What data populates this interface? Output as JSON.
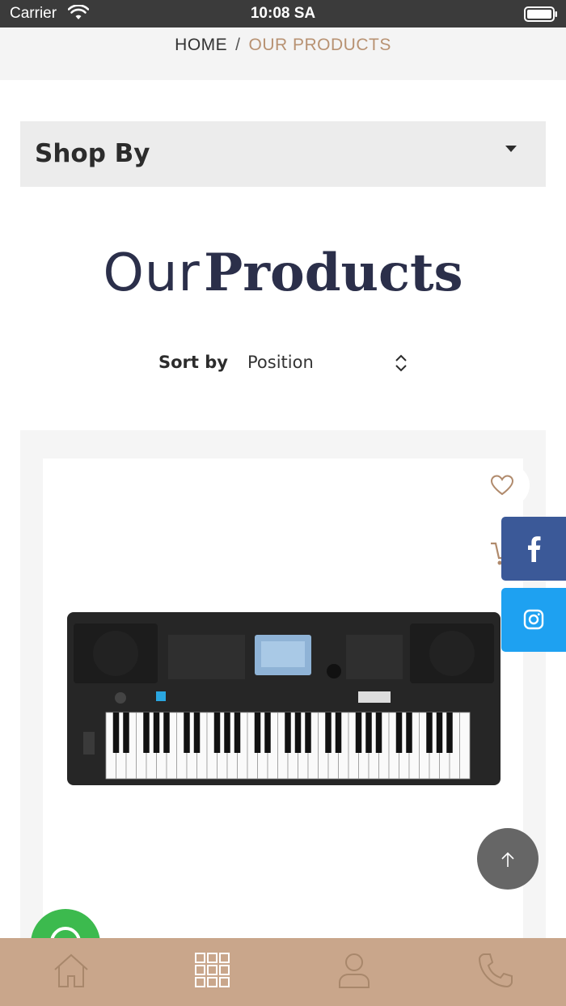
{
  "status_bar": {
    "carrier": "Carrier",
    "time": "10:08 SA"
  },
  "breadcrumb": {
    "home": "HOME",
    "separator": "/",
    "current": "OUR PRODUCTS"
  },
  "shop_by": {
    "label": "Shop By"
  },
  "page_title": {
    "light": "Our",
    "bold": "Products"
  },
  "sort": {
    "label": "Sort by",
    "selected": "Position"
  },
  "social": {
    "facebook_icon": "facebook-icon",
    "instagram_icon": "instagram-icon"
  },
  "product": {
    "image_icon": "keyboard-image"
  },
  "bottom_nav": {
    "items": [
      "home-icon",
      "grid-icon",
      "user-icon",
      "phone-icon"
    ],
    "active_index": 1
  },
  "colors": {
    "accent": "#c9a68b",
    "breadcrumb_current": "#b89272",
    "title": "#2b2f4a",
    "facebook": "#3b5998",
    "instagram": "#1ea1f1",
    "whatsapp": "#3cba4e"
  }
}
